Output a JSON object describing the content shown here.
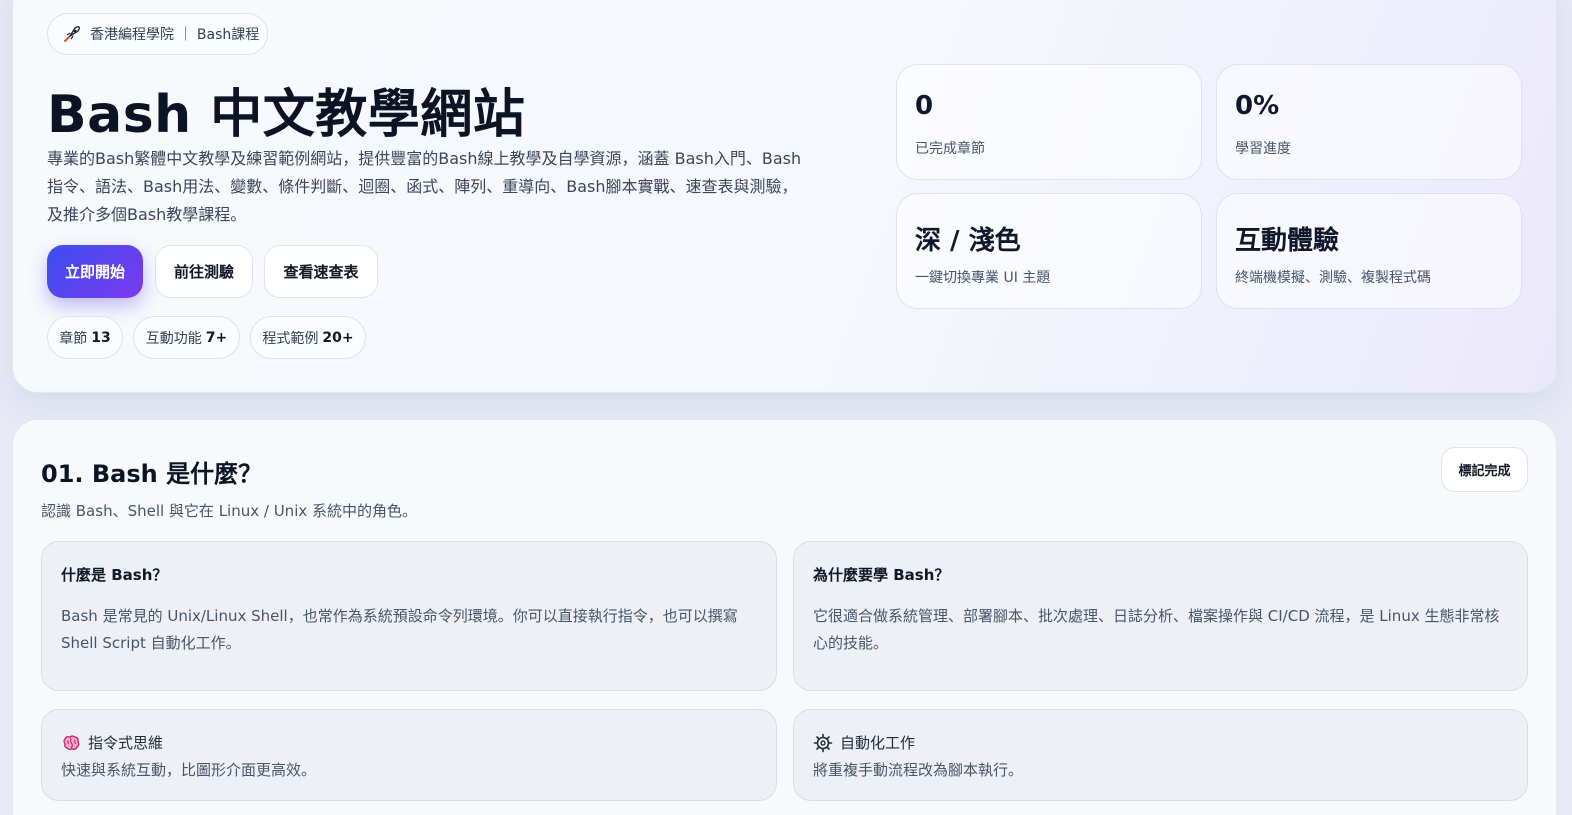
{
  "hero": {
    "badge_text": "香港編程學院 ｜ Bash課程",
    "title": "Bash 中文教學網站",
    "description": "專業的Bash繁體中文教學及練習範例網站，提供豐富的Bash線上教學及自學資源，涵蓋 Bash入門、Bash指令、語法、Bash用法、變數、條件判斷、迴圈、函式、陣列、重導向、Bash腳本實戰、速查表與測驗，及推介多個Bash教學課程。",
    "buttons": {
      "start": "立即開始",
      "quiz": "前往測驗",
      "cheatsheet": "查看速查表"
    },
    "pills": [
      {
        "label": "章節",
        "value": "13"
      },
      {
        "label": "互動功能",
        "value": "7+"
      },
      {
        "label": "程式範例",
        "value": "20+"
      }
    ],
    "stats": [
      {
        "value": "0",
        "label": "已完成章節"
      },
      {
        "value": "0%",
        "label": "學習進度"
      },
      {
        "value": "深 / 淺色",
        "label": "一鍵切換專業 UI 主題"
      },
      {
        "value": "互動體驗",
        "label": "終端機模擬、測驗、複製程式碼"
      }
    ]
  },
  "section": {
    "title": "01. Bash 是什麼？",
    "subtitle": "認識 Bash、Shell 與它在 Linux / Unix 系統中的角色。",
    "mark_done": "標記完成",
    "cards": [
      {
        "heading": "什麼是 Bash？",
        "body": "Bash 是常見的 Unix/Linux Shell，也常作為系統預設命令列環境。你可以直接執行指令，也可以撰寫 Shell Script 自動化工作。"
      },
      {
        "heading": "為什麼要學 Bash？",
        "body": "它很適合做系統管理、部署腳本、批次處理、日誌分析、檔案操作與 CI/CD 流程，是 Linux 生態非常核心的技能。"
      }
    ],
    "features": [
      {
        "icon": "brain-icon",
        "heading": "指令式思維",
        "body": "快速與系統互動，比圖形介面更高效。"
      },
      {
        "icon": "gear-icon",
        "heading": "自動化工作",
        "body": "將重複手動流程改為腳本執行。"
      }
    ]
  }
}
